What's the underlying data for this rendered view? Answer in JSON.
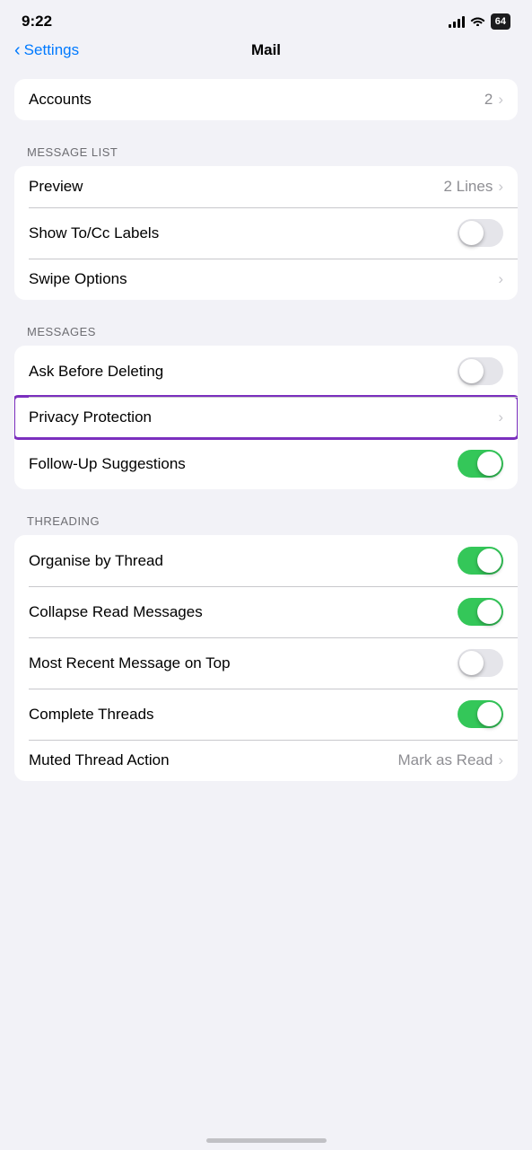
{
  "statusBar": {
    "time": "9:22",
    "battery": "64"
  },
  "navBar": {
    "backLabel": "Settings",
    "title": "Mail"
  },
  "sections": {
    "accounts": {
      "rows": [
        {
          "id": "accounts",
          "label": "Accounts",
          "value": "2",
          "hasChevron": true,
          "hasToggle": false
        }
      ]
    },
    "messageList": {
      "header": "MESSAGE LIST",
      "rows": [
        {
          "id": "preview",
          "label": "Preview",
          "value": "2 Lines",
          "hasChevron": true,
          "hasToggle": false
        },
        {
          "id": "show-to-cc",
          "label": "Show To/Cc Labels",
          "value": "",
          "hasChevron": false,
          "hasToggle": true,
          "toggleOn": false
        },
        {
          "id": "swipe-options",
          "label": "Swipe Options",
          "value": "",
          "hasChevron": true,
          "hasToggle": false
        }
      ]
    },
    "messages": {
      "header": "MESSAGES",
      "rows": [
        {
          "id": "ask-before-deleting",
          "label": "Ask Before Deleting",
          "value": "",
          "hasChevron": false,
          "hasToggle": true,
          "toggleOn": false
        },
        {
          "id": "privacy-protection",
          "label": "Privacy Protection",
          "value": "",
          "hasChevron": true,
          "hasToggle": false,
          "highlighted": true
        },
        {
          "id": "follow-up-suggestions",
          "label": "Follow-Up Suggestions",
          "value": "",
          "hasChevron": false,
          "hasToggle": true,
          "toggleOn": true
        }
      ]
    },
    "threading": {
      "header": "THREADING",
      "rows": [
        {
          "id": "organise-by-thread",
          "label": "Organise by Thread",
          "value": "",
          "hasChevron": false,
          "hasToggle": true,
          "toggleOn": true
        },
        {
          "id": "collapse-read-messages",
          "label": "Collapse Read Messages",
          "value": "",
          "hasChevron": false,
          "hasToggle": true,
          "toggleOn": true
        },
        {
          "id": "most-recent-top",
          "label": "Most Recent Message on Top",
          "value": "",
          "hasChevron": false,
          "hasToggle": true,
          "toggleOn": false
        },
        {
          "id": "complete-threads",
          "label": "Complete Threads",
          "value": "",
          "hasChevron": false,
          "hasToggle": true,
          "toggleOn": true
        },
        {
          "id": "muted-thread-action",
          "label": "Muted Thread Action",
          "value": "Mark as Read",
          "hasChevron": true,
          "hasToggle": false
        }
      ]
    }
  }
}
